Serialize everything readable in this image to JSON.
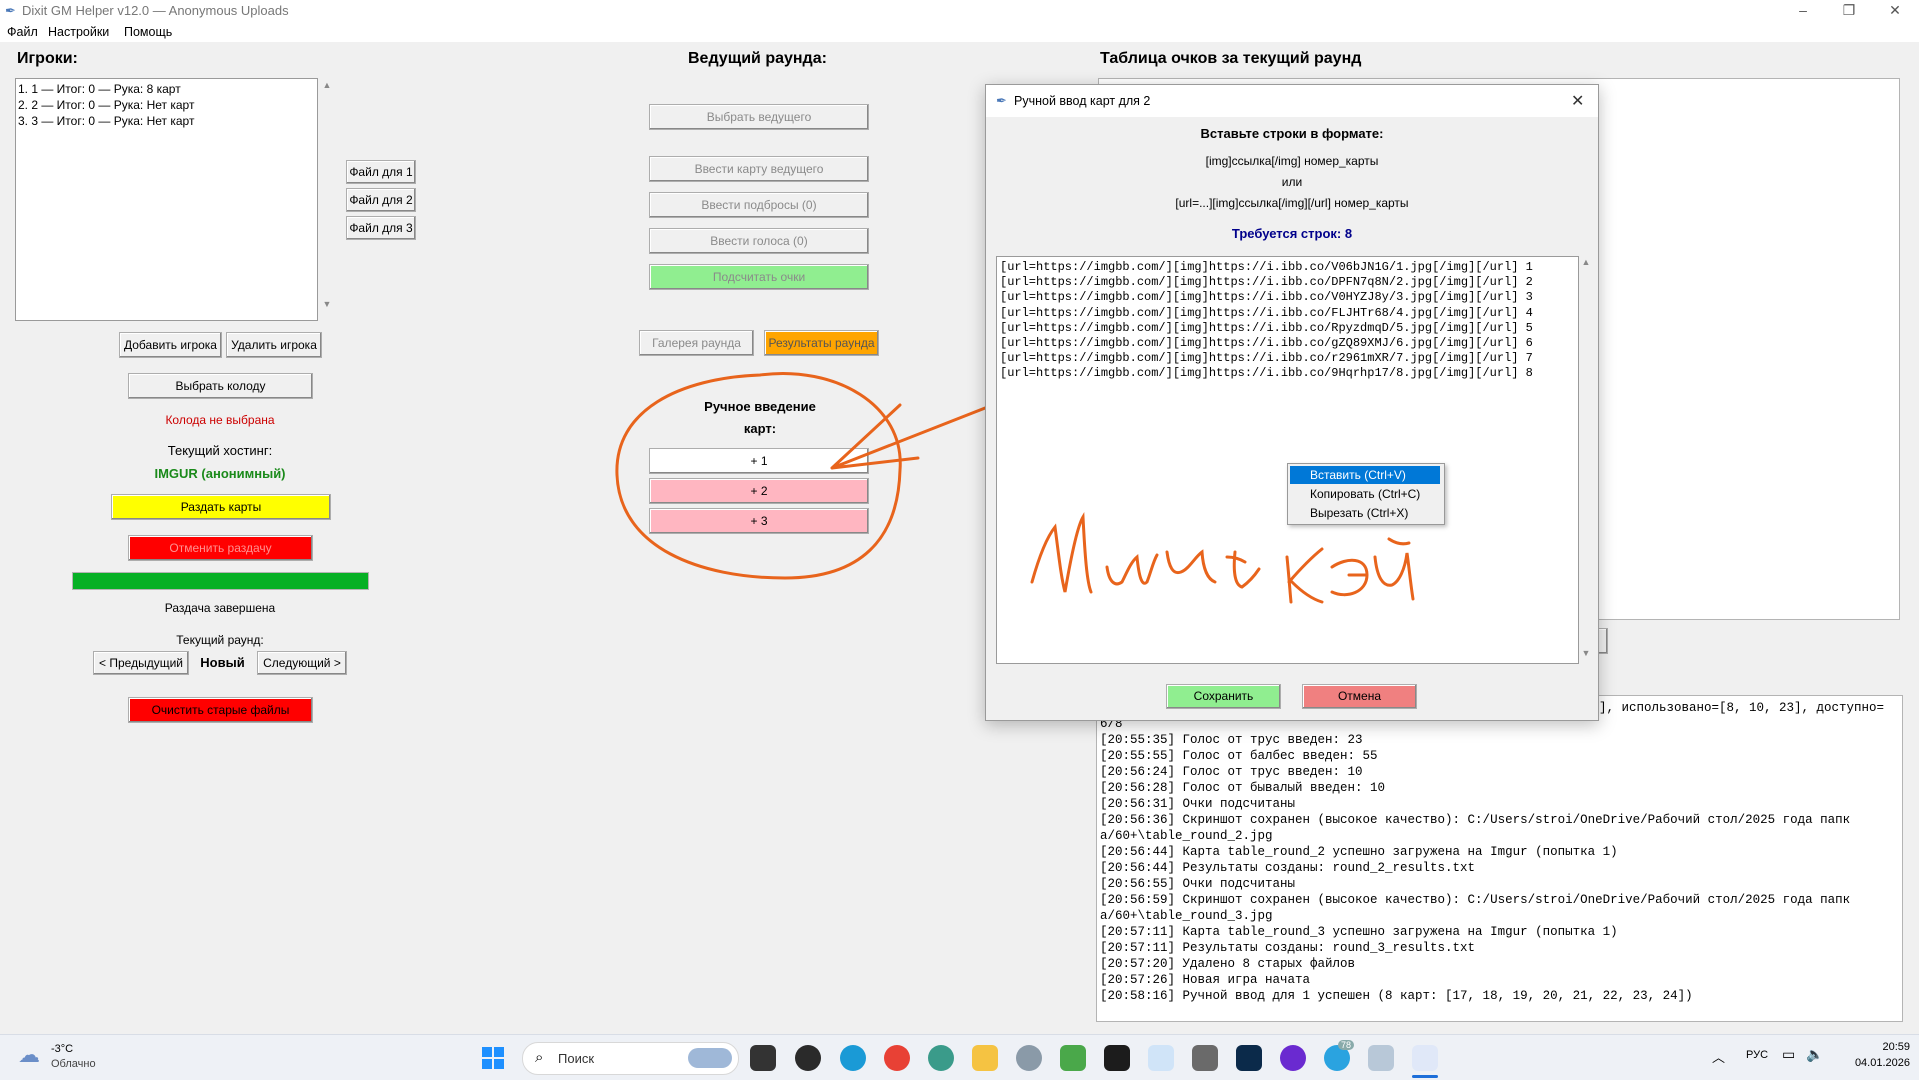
{
  "window": {
    "title": "Dixit GM Helper v12.0 — Anonymous Uploads",
    "menu": [
      "Файл",
      "Настройки",
      "Помощь"
    ]
  },
  "left": {
    "players_header": "Игроки:",
    "players": [
      "1. 1 — Итог: 0 — Рука: 8 карт",
      "2. 2 — Итог: 0 — Рука: Нет карт",
      "3. 3 — Итог: 0 — Рука: Нет карт"
    ],
    "file_buttons": [
      "Файл для 1",
      "Файл для 2",
      "Файл для 3"
    ],
    "add_player": "Добавить игрока",
    "remove_player": "Удалить игрока",
    "choose_deck": "Выбрать колоду",
    "deck_status": "Колода не выбрана",
    "hosting_label": "Текущий хостинг:",
    "hosting_value": "IMGUR (анонимный)",
    "deal_cards": "Раздать карты",
    "cancel_deal": "Отменить раздачу",
    "progress": 1.0,
    "deal_status": "Раздача завершена",
    "round_label": "Текущий раунд:",
    "prev": "< Предыдущий",
    "round_value": "Новый",
    "next": "Следующий >",
    "clear_files": "Очистить старые файлы"
  },
  "middle": {
    "header": "Ведущий раунда:",
    "choose_leader": "Выбрать ведущего",
    "enter_leader_card": "Ввести карту ведущего",
    "enter_throws": "Ввести подбросы (0)",
    "enter_votes": "Ввести голоса (0)",
    "count_points": "Подсчитать очки",
    "gallery": "Галерея раунда",
    "results": "Результаты раунда",
    "manual_title_1": "Ручное введение",
    "manual_title_2": "карт:",
    "plus_buttons": [
      "+ 1",
      "+ 2",
      "+ 3"
    ]
  },
  "right": {
    "header": "Таблица очков за текущий раунд",
    "log_top_fragment": "], использовано=[8, 10, 23], доступно=",
    "log": [
      "6/8",
      "[20:55:35] Голос от трус введен: 23",
      "[20:55:55] Голос от балбес введен: 55",
      "[20:56:24] Голос от трус введен: 10",
      "[20:56:28] Голос от бывалый введен: 10",
      "[20:56:31] Очки подсчитаны",
      "[20:56:36] Скриншот сохранен (высокое качество): C:/Users/stroi/OneDrive/Рабочий стол/2025 года папк",
      "a/60+\\table_round_2.jpg",
      "[20:56:44] Карта table_round_2 успешно загружена на Imgur (попытка 1)",
      "[20:56:44] Результаты созданы: round_2_results.txt",
      "[20:56:55] Очки подсчитаны",
      "[20:56:59] Скриншот сохранен (высокое качество): C:/Users/stroi/OneDrive/Рабочий стол/2025 года папк",
      "a/60+\\table_round_3.jpg",
      "[20:57:11] Карта table_round_3 успешно загружена на Imgur (попытка 1)",
      "[20:57:11] Результаты созданы: round_3_results.txt",
      "[20:57:20] Удалено 8 старых файлов",
      "[20:57:26] Новая игра начата",
      "[20:58:16] Ручной ввод для 1 успешен (8 карт: [17, 18, 19, 20, 21, 22, 23, 24])"
    ]
  },
  "dialog": {
    "title": "Ручной ввод карт для 2",
    "format_header": "Вставьте строки в формате:",
    "format_1": "[img]ссылка[/img] номер_карты",
    "format_or": "или",
    "format_2": "[url=...][img]ссылка[/img][/url] номер_карты",
    "required": "Требуется строк: 8",
    "lines": [
      "[url=https://imgbb.com/][img]https://i.ibb.co/V06bJN1G/1.jpg[/img][/url] 1",
      "[url=https://imgbb.com/][img]https://i.ibb.co/DPFN7q8N/2.jpg[/img][/url] 2",
      "[url=https://imgbb.com/][img]https://i.ibb.co/V0HYZJ8y/3.jpg[/img][/url] 3",
      "[url=https://imgbb.com/][img]https://i.ibb.co/FLJHTr68/4.jpg[/img][/url] 4",
      "[url=https://imgbb.com/][img]https://i.ibb.co/RpyzdmqD/5.jpg[/img][/url] 5",
      "[url=https://imgbb.com/][img]https://i.ibb.co/gZQ89XMJ/6.jpg[/img][/url] 6",
      "[url=https://imgbb.com/][img]https://i.ibb.co/r2961mXR/7.jpg[/img][/url] 7",
      "[url=https://imgbb.com/][img]https://i.ibb.co/9Hqrhp17/8.jpg[/img][/url] 8"
    ],
    "context_menu": [
      "Вставить (Ctrl+V)",
      "Копировать (Ctrl+C)",
      "Вырезать (Ctrl+X)"
    ],
    "save": "Сохранить",
    "cancel": "Отмена"
  },
  "taskbar": {
    "weather_temp": "-3°C",
    "weather_desc": "Облачно",
    "search_placeholder": "Поиск",
    "lang": "РУС",
    "time": "20:59",
    "date": "04.01.2026",
    "telegram_badge": "78"
  },
  "colors": {
    "yellow": "#ffff00",
    "red": "#ff0000",
    "green_btn": "#90ee90",
    "orange_btn": "#ffa500",
    "pink_btn": "#ffb6c1",
    "progress_green": "#06b025",
    "annotation_orange": "#e8641c"
  }
}
